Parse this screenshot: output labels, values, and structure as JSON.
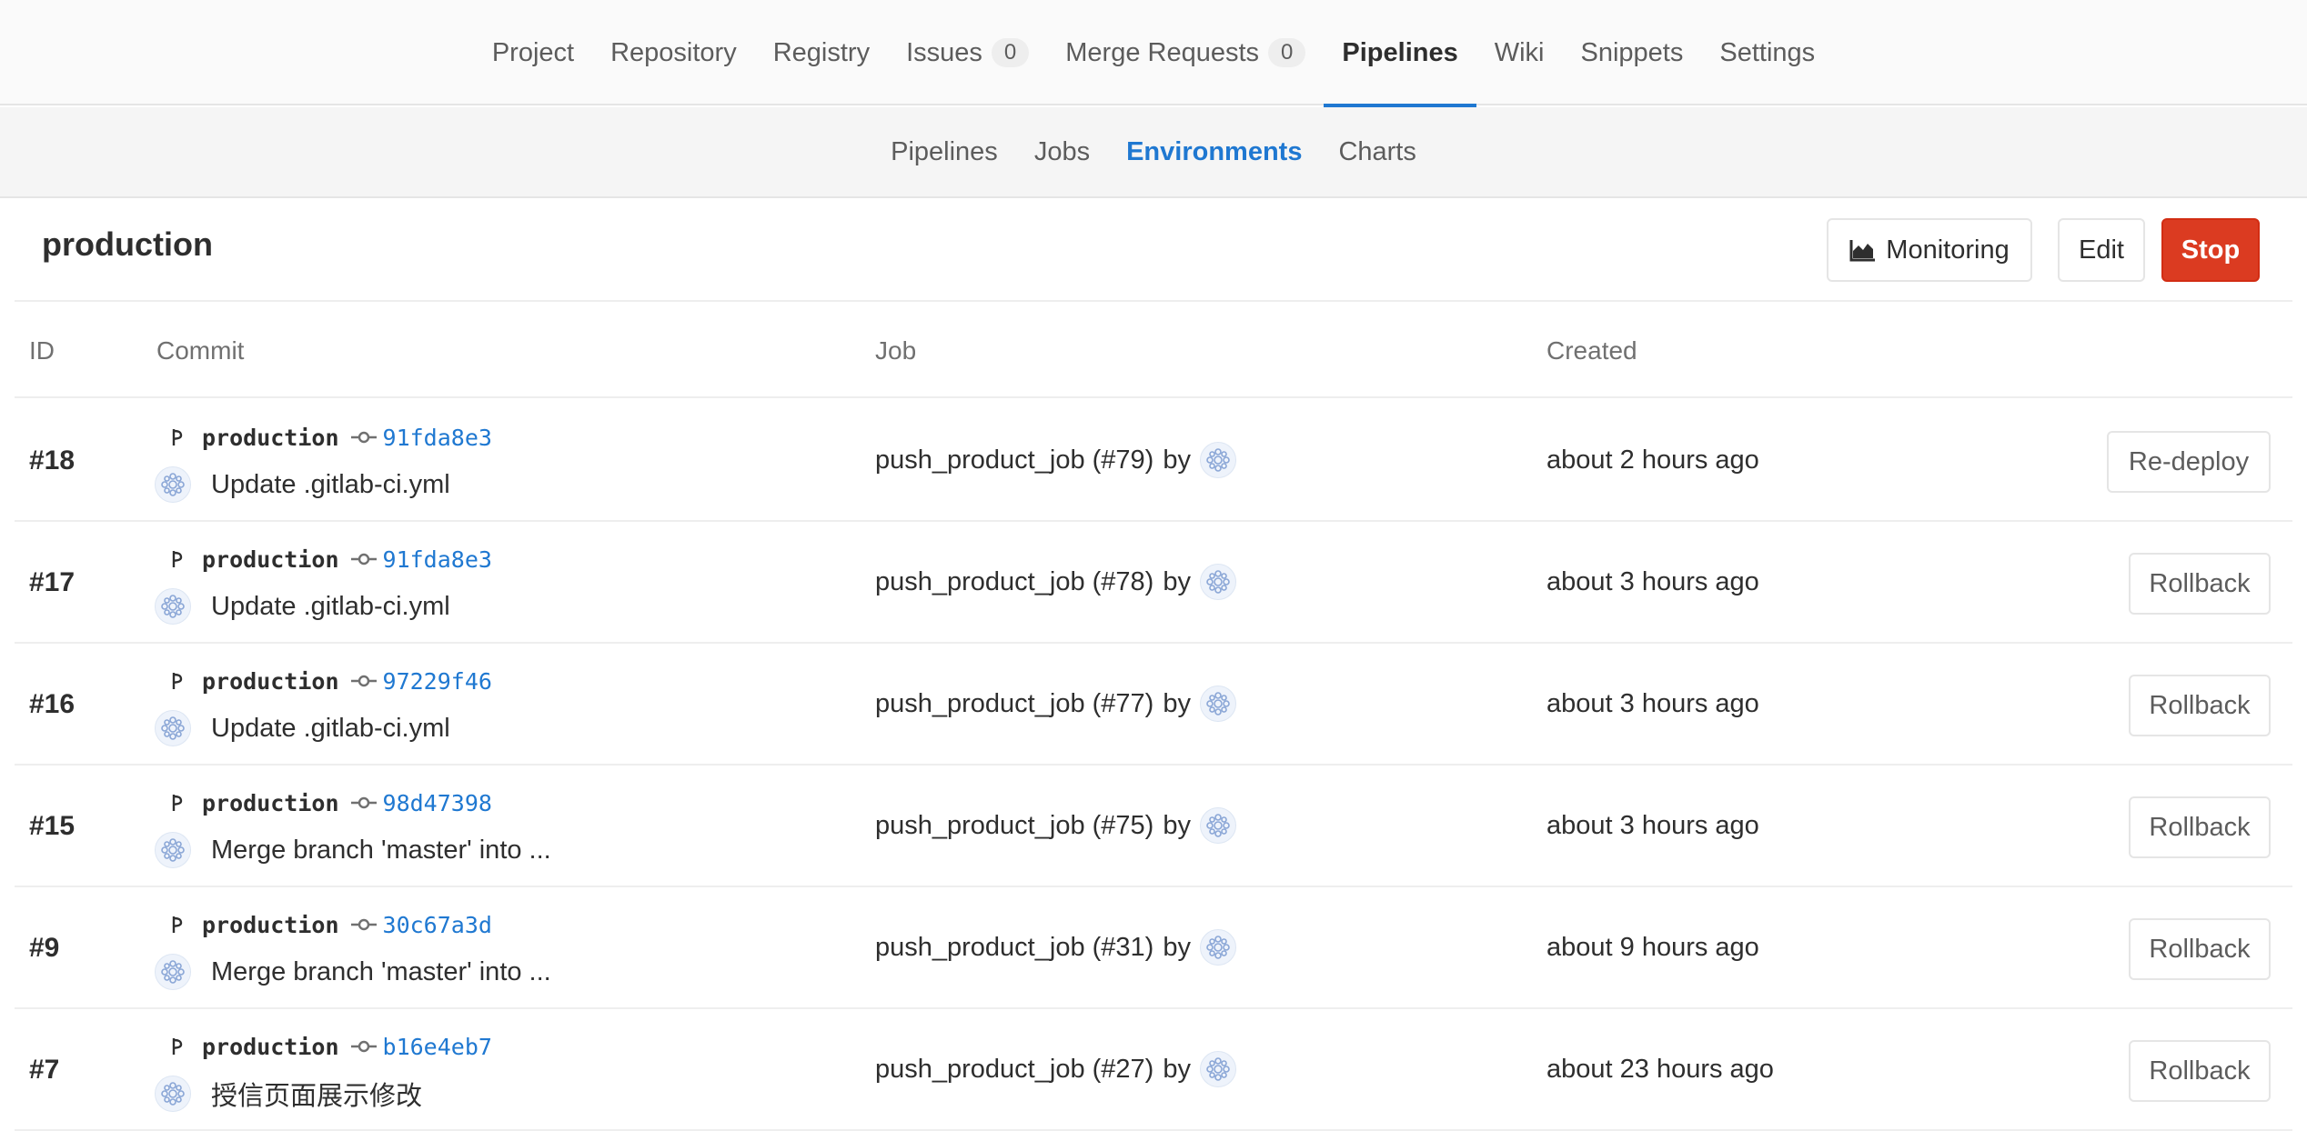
{
  "top_nav": {
    "items": [
      {
        "label": "Project"
      },
      {
        "label": "Repository"
      },
      {
        "label": "Registry"
      },
      {
        "label": "Issues",
        "count": "0"
      },
      {
        "label": "Merge Requests",
        "count": "0"
      },
      {
        "label": "Pipelines",
        "active": true
      },
      {
        "label": "Wiki"
      },
      {
        "label": "Snippets"
      },
      {
        "label": "Settings"
      }
    ]
  },
  "sub_nav": {
    "items": [
      {
        "label": "Pipelines"
      },
      {
        "label": "Jobs"
      },
      {
        "label": "Environments",
        "active": true
      },
      {
        "label": "Charts"
      }
    ]
  },
  "environment": {
    "name": "production",
    "monitoring_label": "Monitoring",
    "edit_label": "Edit",
    "stop_label": "Stop"
  },
  "table": {
    "headers": {
      "id": "ID",
      "commit": "Commit",
      "job": "Job",
      "created": "Created"
    },
    "by_label": "by",
    "rows": [
      {
        "id": "#18",
        "ref": "production",
        "sha": "91fda8e3",
        "message": "Update .gitlab-ci.yml",
        "job": "push_product_job (#79)",
        "created": "about 2 hours ago",
        "action": "Re-deploy"
      },
      {
        "id": "#17",
        "ref": "production",
        "sha": "91fda8e3",
        "message": "Update .gitlab-ci.yml",
        "job": "push_product_job (#78)",
        "created": "about 3 hours ago",
        "action": "Rollback"
      },
      {
        "id": "#16",
        "ref": "production",
        "sha": "97229f46",
        "message": "Update .gitlab-ci.yml",
        "job": "push_product_job (#77)",
        "created": "about 3 hours ago",
        "action": "Rollback"
      },
      {
        "id": "#15",
        "ref": "production",
        "sha": "98d47398",
        "message": "Merge branch 'master' into ...",
        "job": "push_product_job (#75)",
        "created": "about 3 hours ago",
        "action": "Rollback"
      },
      {
        "id": "#9",
        "ref": "production",
        "sha": "30c67a3d",
        "message": "Merge branch 'master' into ...",
        "job": "push_product_job (#31)",
        "created": "about 9 hours ago",
        "action": "Rollback"
      },
      {
        "id": "#7",
        "ref": "production",
        "sha": "b16e4eb7",
        "message": "授信页面展示修改",
        "job": "push_product_job (#27)",
        "created": "about 23 hours ago",
        "action": "Rollback"
      }
    ]
  },
  "colors": {
    "link": "#1f78d1",
    "stop_button": "#db3b21",
    "active_tab_underline": "#1f78d1"
  },
  "icons": [
    "branch-icon",
    "commit-icon",
    "avatar",
    "area-chart-icon"
  ]
}
